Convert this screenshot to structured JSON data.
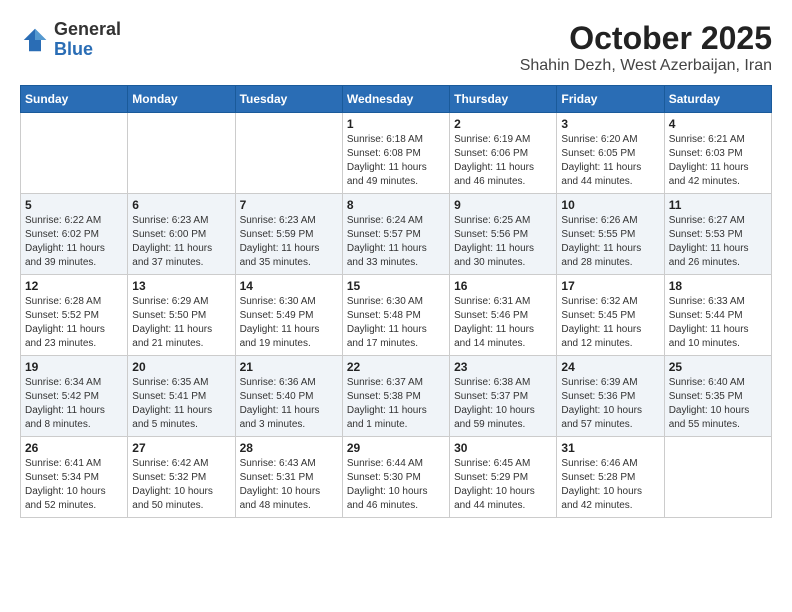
{
  "header": {
    "logo": {
      "general": "General",
      "blue": "Blue"
    },
    "title": "October 2025",
    "subtitle": "Shahin Dezh, West Azerbaijan, Iran"
  },
  "weekdays": [
    "Sunday",
    "Monday",
    "Tuesday",
    "Wednesday",
    "Thursday",
    "Friday",
    "Saturday"
  ],
  "weeks": [
    [
      {
        "day": "",
        "info": ""
      },
      {
        "day": "",
        "info": ""
      },
      {
        "day": "",
        "info": ""
      },
      {
        "day": "1",
        "info": "Sunrise: 6:18 AM\nSunset: 6:08 PM\nDaylight: 11 hours and 49 minutes."
      },
      {
        "day": "2",
        "info": "Sunrise: 6:19 AM\nSunset: 6:06 PM\nDaylight: 11 hours and 46 minutes."
      },
      {
        "day": "3",
        "info": "Sunrise: 6:20 AM\nSunset: 6:05 PM\nDaylight: 11 hours and 44 minutes."
      },
      {
        "day": "4",
        "info": "Sunrise: 6:21 AM\nSunset: 6:03 PM\nDaylight: 11 hours and 42 minutes."
      }
    ],
    [
      {
        "day": "5",
        "info": "Sunrise: 6:22 AM\nSunset: 6:02 PM\nDaylight: 11 hours and 39 minutes."
      },
      {
        "day": "6",
        "info": "Sunrise: 6:23 AM\nSunset: 6:00 PM\nDaylight: 11 hours and 37 minutes."
      },
      {
        "day": "7",
        "info": "Sunrise: 6:23 AM\nSunset: 5:59 PM\nDaylight: 11 hours and 35 minutes."
      },
      {
        "day": "8",
        "info": "Sunrise: 6:24 AM\nSunset: 5:57 PM\nDaylight: 11 hours and 33 minutes."
      },
      {
        "day": "9",
        "info": "Sunrise: 6:25 AM\nSunset: 5:56 PM\nDaylight: 11 hours and 30 minutes."
      },
      {
        "day": "10",
        "info": "Sunrise: 6:26 AM\nSunset: 5:55 PM\nDaylight: 11 hours and 28 minutes."
      },
      {
        "day": "11",
        "info": "Sunrise: 6:27 AM\nSunset: 5:53 PM\nDaylight: 11 hours and 26 minutes."
      }
    ],
    [
      {
        "day": "12",
        "info": "Sunrise: 6:28 AM\nSunset: 5:52 PM\nDaylight: 11 hours and 23 minutes."
      },
      {
        "day": "13",
        "info": "Sunrise: 6:29 AM\nSunset: 5:50 PM\nDaylight: 11 hours and 21 minutes."
      },
      {
        "day": "14",
        "info": "Sunrise: 6:30 AM\nSunset: 5:49 PM\nDaylight: 11 hours and 19 minutes."
      },
      {
        "day": "15",
        "info": "Sunrise: 6:30 AM\nSunset: 5:48 PM\nDaylight: 11 hours and 17 minutes."
      },
      {
        "day": "16",
        "info": "Sunrise: 6:31 AM\nSunset: 5:46 PM\nDaylight: 11 hours and 14 minutes."
      },
      {
        "day": "17",
        "info": "Sunrise: 6:32 AM\nSunset: 5:45 PM\nDaylight: 11 hours and 12 minutes."
      },
      {
        "day": "18",
        "info": "Sunrise: 6:33 AM\nSunset: 5:44 PM\nDaylight: 11 hours and 10 minutes."
      }
    ],
    [
      {
        "day": "19",
        "info": "Sunrise: 6:34 AM\nSunset: 5:42 PM\nDaylight: 11 hours and 8 minutes."
      },
      {
        "day": "20",
        "info": "Sunrise: 6:35 AM\nSunset: 5:41 PM\nDaylight: 11 hours and 5 minutes."
      },
      {
        "day": "21",
        "info": "Sunrise: 6:36 AM\nSunset: 5:40 PM\nDaylight: 11 hours and 3 minutes."
      },
      {
        "day": "22",
        "info": "Sunrise: 6:37 AM\nSunset: 5:38 PM\nDaylight: 11 hours and 1 minute."
      },
      {
        "day": "23",
        "info": "Sunrise: 6:38 AM\nSunset: 5:37 PM\nDaylight: 10 hours and 59 minutes."
      },
      {
        "day": "24",
        "info": "Sunrise: 6:39 AM\nSunset: 5:36 PM\nDaylight: 10 hours and 57 minutes."
      },
      {
        "day": "25",
        "info": "Sunrise: 6:40 AM\nSunset: 5:35 PM\nDaylight: 10 hours and 55 minutes."
      }
    ],
    [
      {
        "day": "26",
        "info": "Sunrise: 6:41 AM\nSunset: 5:34 PM\nDaylight: 10 hours and 52 minutes."
      },
      {
        "day": "27",
        "info": "Sunrise: 6:42 AM\nSunset: 5:32 PM\nDaylight: 10 hours and 50 minutes."
      },
      {
        "day": "28",
        "info": "Sunrise: 6:43 AM\nSunset: 5:31 PM\nDaylight: 10 hours and 48 minutes."
      },
      {
        "day": "29",
        "info": "Sunrise: 6:44 AM\nSunset: 5:30 PM\nDaylight: 10 hours and 46 minutes."
      },
      {
        "day": "30",
        "info": "Sunrise: 6:45 AM\nSunset: 5:29 PM\nDaylight: 10 hours and 44 minutes."
      },
      {
        "day": "31",
        "info": "Sunrise: 6:46 AM\nSunset: 5:28 PM\nDaylight: 10 hours and 42 minutes."
      },
      {
        "day": "",
        "info": ""
      }
    ]
  ]
}
